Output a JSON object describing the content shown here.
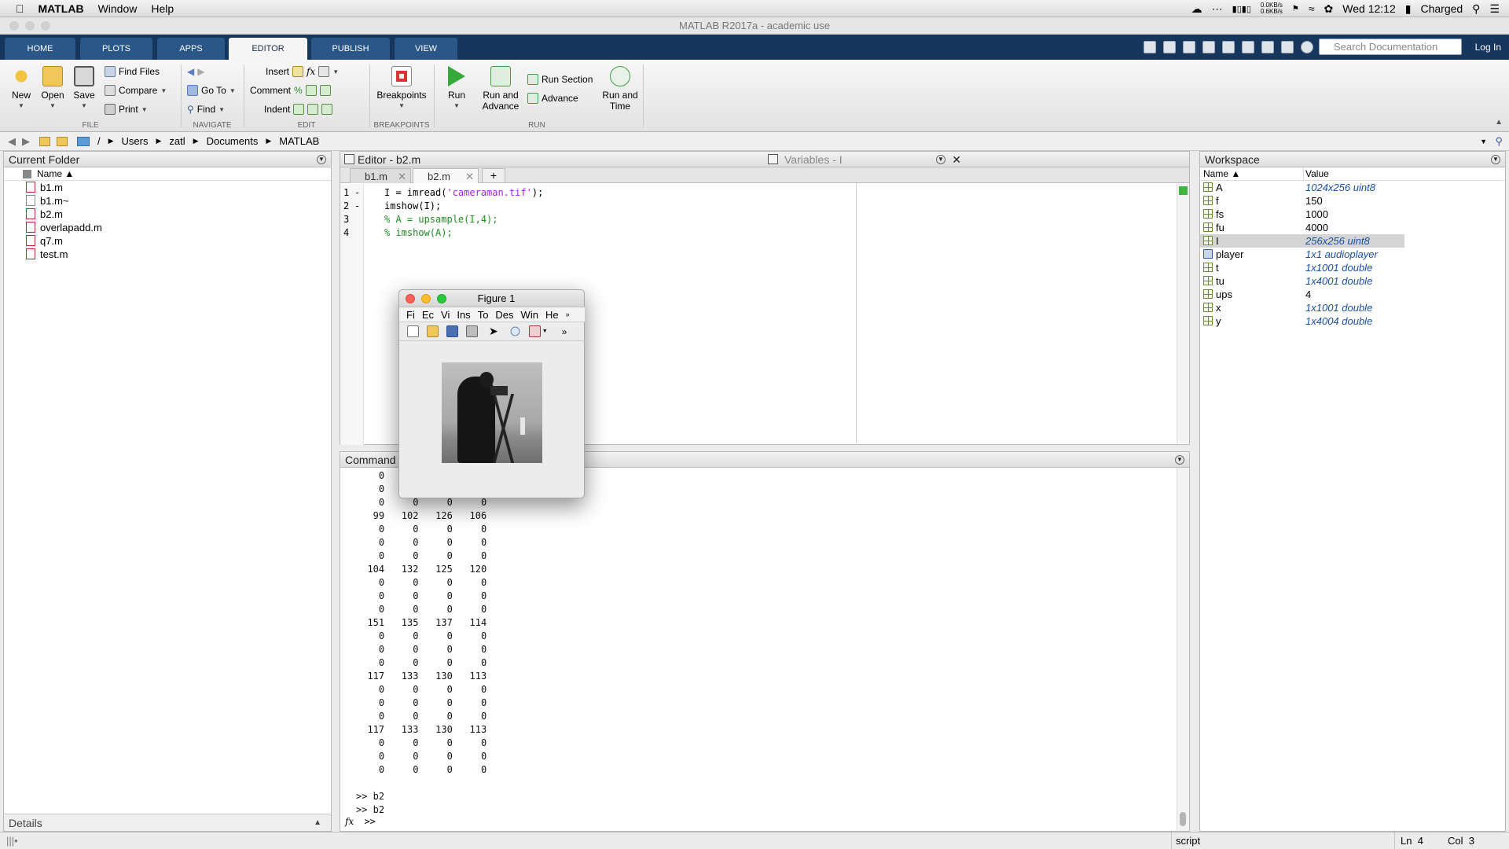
{
  "menubar": {
    "app_name": "MATLAB",
    "items": [
      "Window",
      "Help"
    ],
    "net_up": "0.0KB/s",
    "net_down": "0.6KB/s",
    "clock": "Wed 12:12",
    "battery": "Charged"
  },
  "window": {
    "title": "MATLAB R2017a - academic use"
  },
  "ribbon": {
    "tabs": [
      "HOME",
      "PLOTS",
      "APPS",
      "EDITOR",
      "PUBLISH",
      "VIEW"
    ],
    "active_tab": "EDITOR",
    "search_placeholder": "Search Documentation",
    "login": "Log In",
    "file": {
      "label": "FILE",
      "new": "New",
      "open": "Open",
      "save": "Save",
      "find_files": "Find Files",
      "compare": "Compare",
      "print": "Print"
    },
    "navigate": {
      "label": "NAVIGATE",
      "goto": "Go To",
      "find": "Find"
    },
    "edit": {
      "label": "EDIT",
      "insert": "Insert",
      "comment": "Comment",
      "indent": "Indent"
    },
    "breakpoints": {
      "label": "BREAKPOINTS",
      "button": "Breakpoints"
    },
    "run": {
      "label": "RUN",
      "run": "Run",
      "run_advance_1": "Run and",
      "run_advance_2": "Advance",
      "run_section": "Run Section",
      "advance": "Advance",
      "run_time_1": "Run and",
      "run_time_2": "Time"
    }
  },
  "path": {
    "root": "/",
    "parts": [
      "Users",
      "zatl",
      "Documents",
      "MATLAB"
    ]
  },
  "current_folder": {
    "title": "Current Folder",
    "col_name": "Name ▲",
    "files": [
      "b1.m",
      "b1.m~",
      "b2.m",
      "overlapadd.m",
      "q7.m",
      "test.m"
    ],
    "details": "Details"
  },
  "editor": {
    "title": "Editor - b2.m",
    "variables_title": "Variables - I",
    "tabs": [
      "b1.m",
      "b2.m"
    ],
    "active_tab": "b2.m",
    "lines": [
      {
        "num": "1",
        "mark": "-",
        "pre": "I = imread(",
        "str": "'cameraman.tif'",
        "post": ");",
        "comment": ""
      },
      {
        "num": "2",
        "mark": "-",
        "pre": "imshow(I);",
        "str": "",
        "post": "",
        "comment": ""
      },
      {
        "num": "3",
        "mark": "",
        "pre": "",
        "str": "",
        "post": "",
        "comment": "% A = upsample(I,4);"
      },
      {
        "num": "4",
        "mark": "",
        "pre": "",
        "str": "",
        "post": "",
        "comment": "% imshow(A);"
      }
    ]
  },
  "command_window": {
    "title": "Command Window",
    "output": "    0\n    0\n    0     0     0     0\n   99   102   126   106\n    0     0     0     0\n    0     0     0     0\n    0     0     0     0\n  104   132   125   120\n    0     0     0     0\n    0     0     0     0\n    0     0     0     0\n  151   135   137   114\n    0     0     0     0\n    0     0     0     0\n    0     0     0     0\n  117   133   130   113\n    0     0     0     0\n    0     0     0     0\n    0     0     0     0\n  117   133   130   113\n    0     0     0     0\n    0     0     0     0\n    0     0     0     0\n\n>> b2\n>> b2",
    "prompt": ">>",
    "fx": "fx"
  },
  "workspace": {
    "title": "Workspace",
    "col_name": "Name ▲",
    "col_value": "Value",
    "rows": [
      {
        "name": "A",
        "value": "1024x256 uint8",
        "italic": true
      },
      {
        "name": "f",
        "value": "150",
        "italic": false
      },
      {
        "name": "fs",
        "value": "1000",
        "italic": false
      },
      {
        "name": "fu",
        "value": "4000",
        "italic": false
      },
      {
        "name": "I",
        "value": "256x256 uint8",
        "italic": true
      },
      {
        "name": "player",
        "value": "1x1 audioplayer",
        "italic": true
      },
      {
        "name": "t",
        "value": "1x1001 double",
        "italic": true
      },
      {
        "name": "tu",
        "value": "1x4001 double",
        "italic": true
      },
      {
        "name": "ups",
        "value": "4",
        "italic": false
      },
      {
        "name": "x",
        "value": "1x1001 double",
        "italic": true
      },
      {
        "name": "y",
        "value": "1x4004 double",
        "italic": true
      }
    ],
    "selected": "I"
  },
  "figure": {
    "title": "Figure 1",
    "menu": [
      "Fi",
      "Ec",
      "Vi",
      "Ins",
      "To",
      "Des",
      "Win",
      "He"
    ]
  },
  "status": {
    "mode": "script",
    "ln_label": "Ln",
    "ln": "4",
    "col_label": "Col",
    "col": "3"
  },
  "colors": {
    "ribbon_bg": "#16365d",
    "tab_bg": "#2a5688",
    "string": "#a020f0",
    "comment": "#228b22",
    "ws_value": "#1b4fa0"
  }
}
